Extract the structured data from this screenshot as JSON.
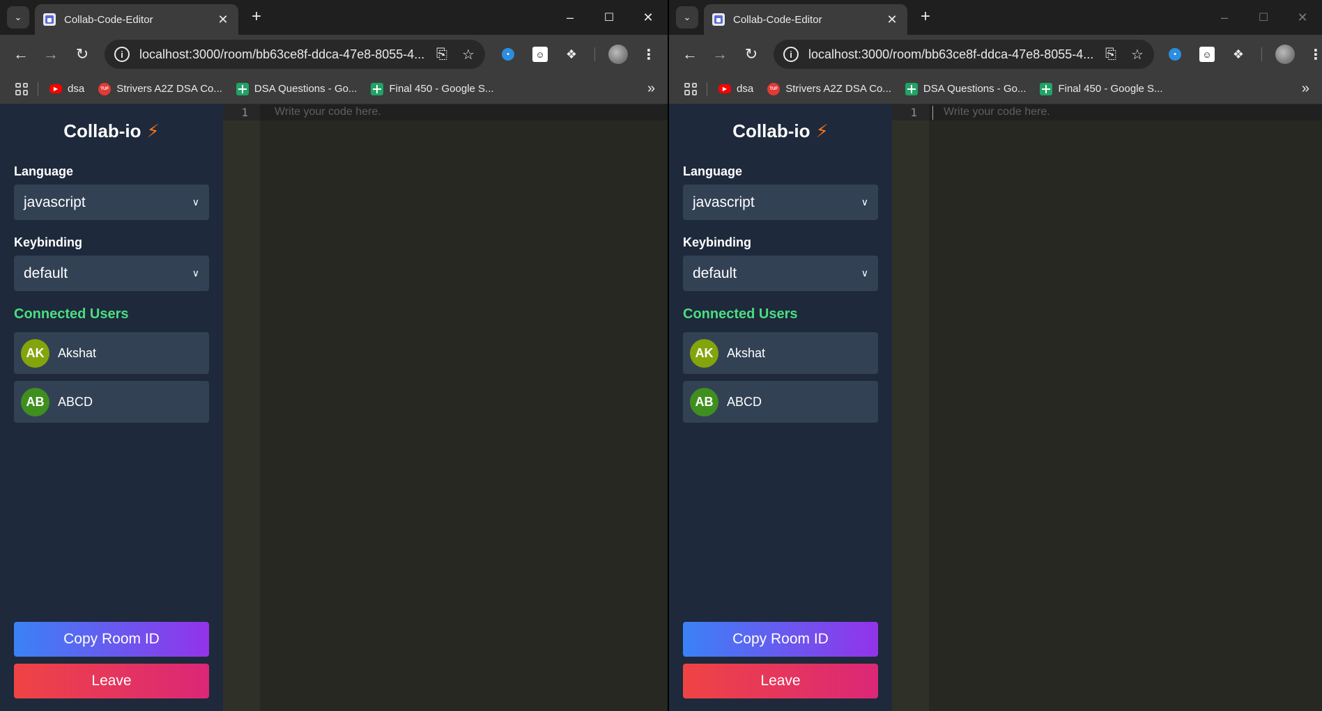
{
  "windows": [
    {
      "tab": {
        "title": "Collab-Code-Editor"
      },
      "address_bar": {
        "url": "localhost:3000/room/bb63ce8f-ddca-47e8-8055-4..."
      },
      "bookmarks": [
        {
          "label": "dsa",
          "icon": "youtube-icon"
        },
        {
          "label": "Strivers A2Z DSA Co...",
          "icon": "tuf-icon"
        },
        {
          "label": "DSA Questions - Go...",
          "icon": "sheets-icon"
        },
        {
          "label": "Final 450 - Google S...",
          "icon": "sheets-icon"
        }
      ],
      "app": {
        "brand": "Collab-io",
        "language_label": "Language",
        "language_value": "javascript",
        "keybinding_label": "Keybinding",
        "keybinding_value": "default",
        "connected_title": "Connected Users",
        "users": [
          {
            "initials": "AK",
            "name": "Akshat",
            "color": "#84a40c"
          },
          {
            "initials": "AB",
            "name": "ABCD",
            "color": "#3f8f1f"
          }
        ],
        "copy_button": "Copy Room ID",
        "leave_button": "Leave"
      },
      "editor": {
        "line_number": "1",
        "placeholder": "Write your code here."
      }
    },
    {
      "tab": {
        "title": "Collab-Code-Editor"
      },
      "address_bar": {
        "url": "localhost:3000/room/bb63ce8f-ddca-47e8-8055-4..."
      },
      "bookmarks": [
        {
          "label": "dsa",
          "icon": "youtube-icon"
        },
        {
          "label": "Strivers A2Z DSA Co...",
          "icon": "tuf-icon"
        },
        {
          "label": "DSA Questions - Go...",
          "icon": "sheets-icon"
        },
        {
          "label": "Final 450 - Google S...",
          "icon": "sheets-icon"
        }
      ],
      "app": {
        "brand": "Collab-io",
        "language_label": "Language",
        "language_value": "javascript",
        "keybinding_label": "Keybinding",
        "keybinding_value": "default",
        "connected_title": "Connected Users",
        "users": [
          {
            "initials": "AK",
            "name": "Akshat",
            "color": "#84a40c"
          },
          {
            "initials": "AB",
            "name": "ABCD",
            "color": "#3f8f1f"
          }
        ],
        "copy_button": "Copy Room ID",
        "leave_button": "Leave"
      },
      "editor": {
        "line_number": "1",
        "placeholder": "Write your code here."
      }
    }
  ],
  "colors": {
    "sidebar_bg": "#1e293b",
    "card_bg": "#334155",
    "accent_green": "#4ade80",
    "bolt_orange": "#f97316",
    "editor_bg": "#272822"
  }
}
